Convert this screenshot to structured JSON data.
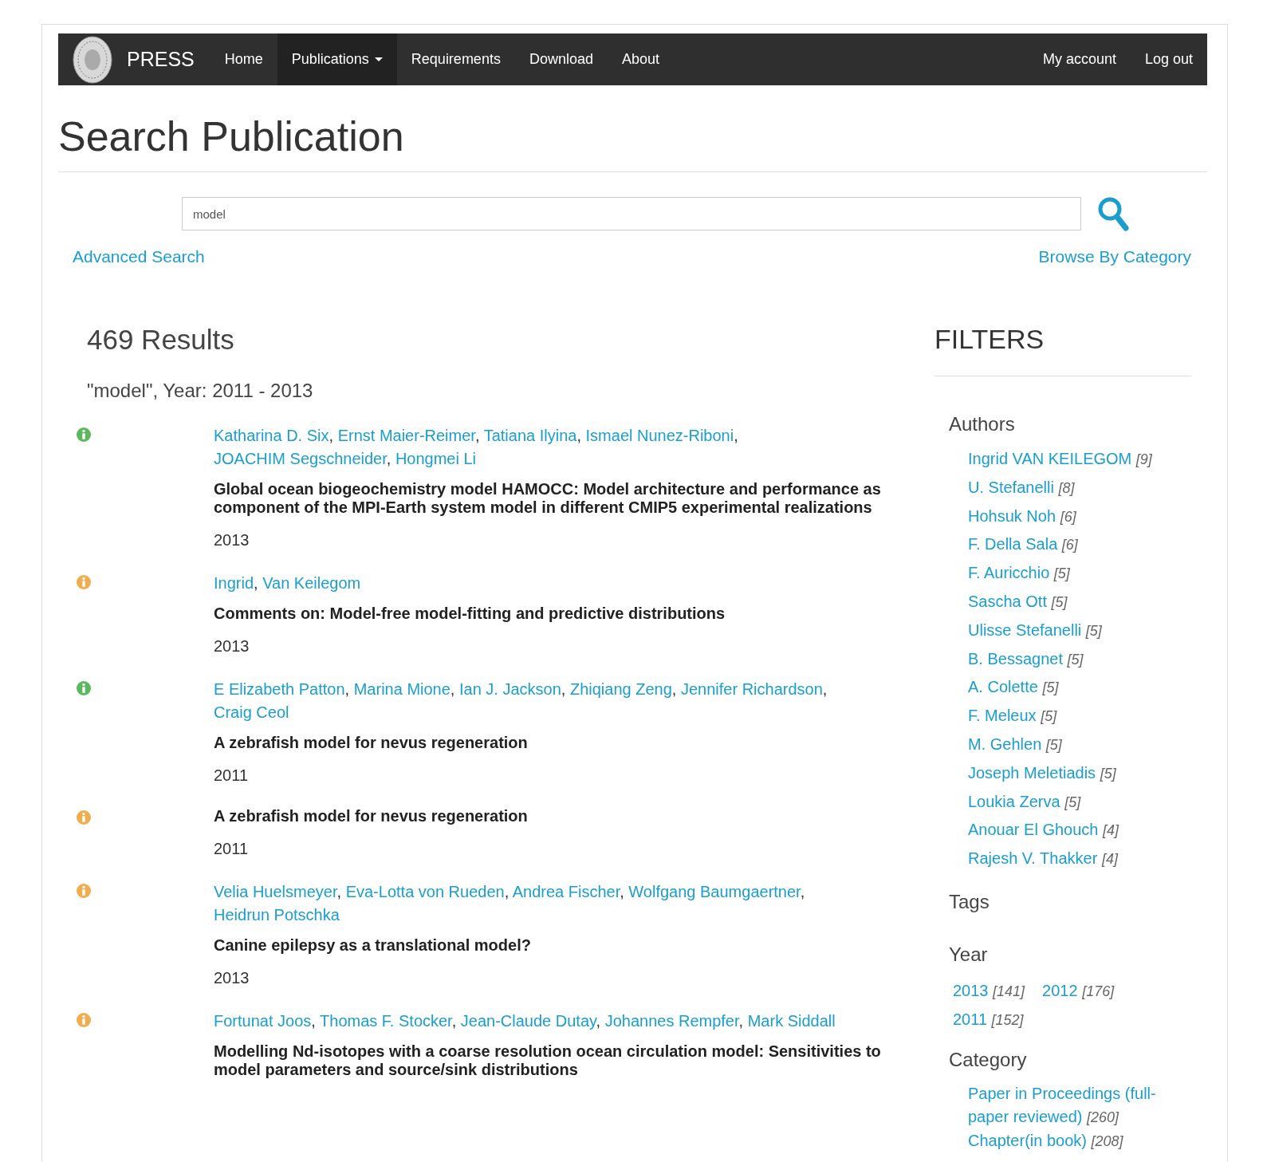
{
  "navbar": {
    "brand": "PRESS",
    "items": [
      {
        "label": "Home",
        "selected": false,
        "dropdown": false
      },
      {
        "label": "Publications",
        "selected": true,
        "dropdown": true
      },
      {
        "label": "Requirements",
        "selected": false,
        "dropdown": false
      },
      {
        "label": "Download",
        "selected": false,
        "dropdown": false
      },
      {
        "label": "About",
        "selected": false,
        "dropdown": false
      }
    ],
    "right_items": [
      "My account",
      "Log out"
    ]
  },
  "page_title": "Search Publication",
  "search": {
    "value": "model"
  },
  "author_separator": ",",
  "advanced_search": "Advanced Search",
  "browse_by_category": "Browse By Category",
  "results_count": "469 Results",
  "query_summary": "\"model\", Year: 2011 - 2013",
  "results": [
    {
      "color": "#5cb85c",
      "authors": [
        "Katharina D. Six",
        "Ernst Maier-Reimer",
        "Tatiana Ilyina",
        "Ismael Nunez-Riboni",
        "JOACHIM Segschneider",
        "Hongmei Li"
      ],
      "title": "Global ocean biogeochemistry model HAMOCC: Model architecture and performance as component of the MPI-Earth system model in different CMIP5 experimental realizations",
      "year": "2013"
    },
    {
      "color": "#f0ad4e",
      "authors": [
        "Ingrid",
        "Van Keilegom"
      ],
      "title": "Comments on: Model-free model-fitting and predictive distributions",
      "year": "2013"
    },
    {
      "color": "#5cb85c",
      "authors": [
        "E Elizabeth Patton",
        "Marina Mione",
        "Ian J. Jackson",
        "Zhiqiang Zeng",
        "Jennifer Richardson",
        "Craig Ceol"
      ],
      "title": "A zebrafish model for nevus regeneration",
      "year": "2011"
    },
    {
      "color": "#f0ad4e",
      "title": "A zebrafish model for nevus regeneration",
      "year": "2011"
    },
    {
      "color": "#f0ad4e",
      "authors": [
        "Velia Huelsmeyer",
        "Eva-Lotta von Rueden",
        "Andrea Fischer",
        "Wolfgang Baumgaertner",
        "Heidrun Potschka"
      ],
      "title": "Canine epilepsy as a translational model?",
      "year": "2013"
    },
    {
      "color": "#f0ad4e",
      "authors": [
        "Fortunat Joos",
        "Thomas F. Stocker",
        "Jean-Claude Dutay",
        "Johannes Rempfer",
        "Mark Siddall"
      ],
      "title": "Modelling Nd-isotopes with a coarse resolution ocean circulation model: Sensitivities to model parameters and source/sink distributions"
    }
  ],
  "filters": {
    "heading": "FILTERS",
    "authors_heading": "Authors",
    "authors": [
      {
        "name": "Ingrid VAN KEILEGOM",
        "count": "[9]"
      },
      {
        "name": "U. Stefanelli",
        "count": "[8]"
      },
      {
        "name": "Hohsuk Noh",
        "count": "[6]"
      },
      {
        "name": "F. Della Sala",
        "count": "[6]"
      },
      {
        "name": "F. Auricchio",
        "count": "[5]"
      },
      {
        "name": "Sascha Ott",
        "count": "[5]"
      },
      {
        "name": "Ulisse Stefanelli",
        "count": "[5]"
      },
      {
        "name": "B. Bessagnet",
        "count": "[5]"
      },
      {
        "name": "A. Colette",
        "count": "[5]"
      },
      {
        "name": "F. Meleux",
        "count": "[5]"
      },
      {
        "name": "M. Gehlen",
        "count": "[5]"
      },
      {
        "name": "Joseph Meletiadis",
        "count": "[5]"
      },
      {
        "name": "Loukia Zerva",
        "count": "[5]"
      },
      {
        "name": "Anouar El Ghouch",
        "count": "[4]"
      },
      {
        "name": "Rajesh V. Thakker",
        "count": "[4]"
      }
    ],
    "tags_heading": "Tags",
    "year_heading": "Year",
    "years": [
      {
        "name": "2013",
        "count": "[141]"
      },
      {
        "name": "2012",
        "count": "[176]"
      },
      {
        "name": "2011",
        "count": "[152]"
      }
    ],
    "category_heading": "Category",
    "categories": [
      {
        "name": "Paper in Proceedings (full-paper reviewed)",
        "count": "[260]"
      },
      {
        "name": "Chapter(in book)",
        "count": "[208]"
      }
    ]
  }
}
